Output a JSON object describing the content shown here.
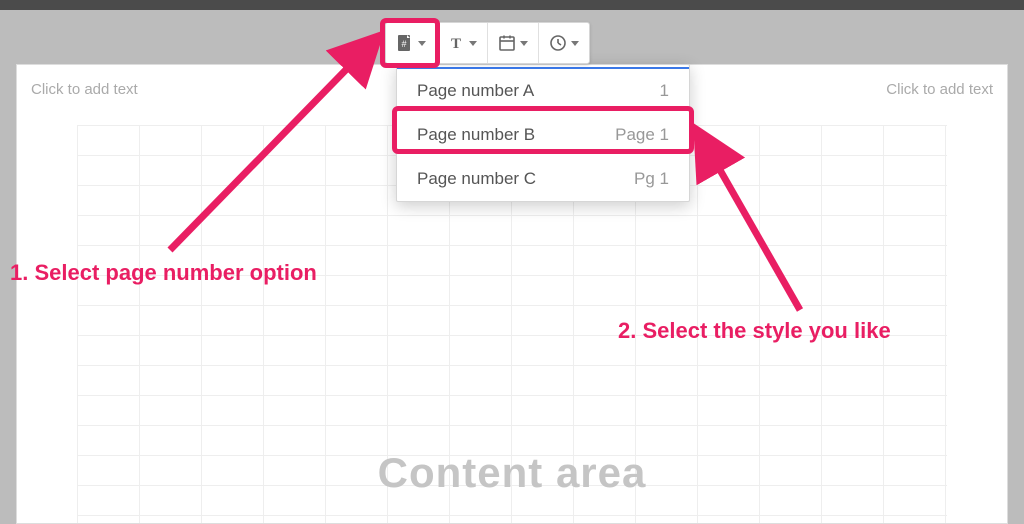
{
  "header": {
    "left_placeholder": "Click to add text",
    "right_placeholder": "Click to add text"
  },
  "toolbar": {
    "items": [
      {
        "name": "page-number",
        "icon": "page-hash"
      },
      {
        "name": "text",
        "icon": "text-t"
      },
      {
        "name": "date",
        "icon": "calendar"
      },
      {
        "name": "time",
        "icon": "clock"
      }
    ]
  },
  "dropdown": {
    "items": [
      {
        "label": "Page number A",
        "value": "1"
      },
      {
        "label": "Page number B",
        "value": "Page 1"
      },
      {
        "label": "Page number C",
        "value": "Pg 1"
      }
    ]
  },
  "content_area_label": "Content area",
  "annotations": {
    "step1": "1. Select page number option",
    "step2": "2. Select the style you like"
  },
  "colors": {
    "accent": "#e91e63",
    "link": "#3b78e7"
  }
}
